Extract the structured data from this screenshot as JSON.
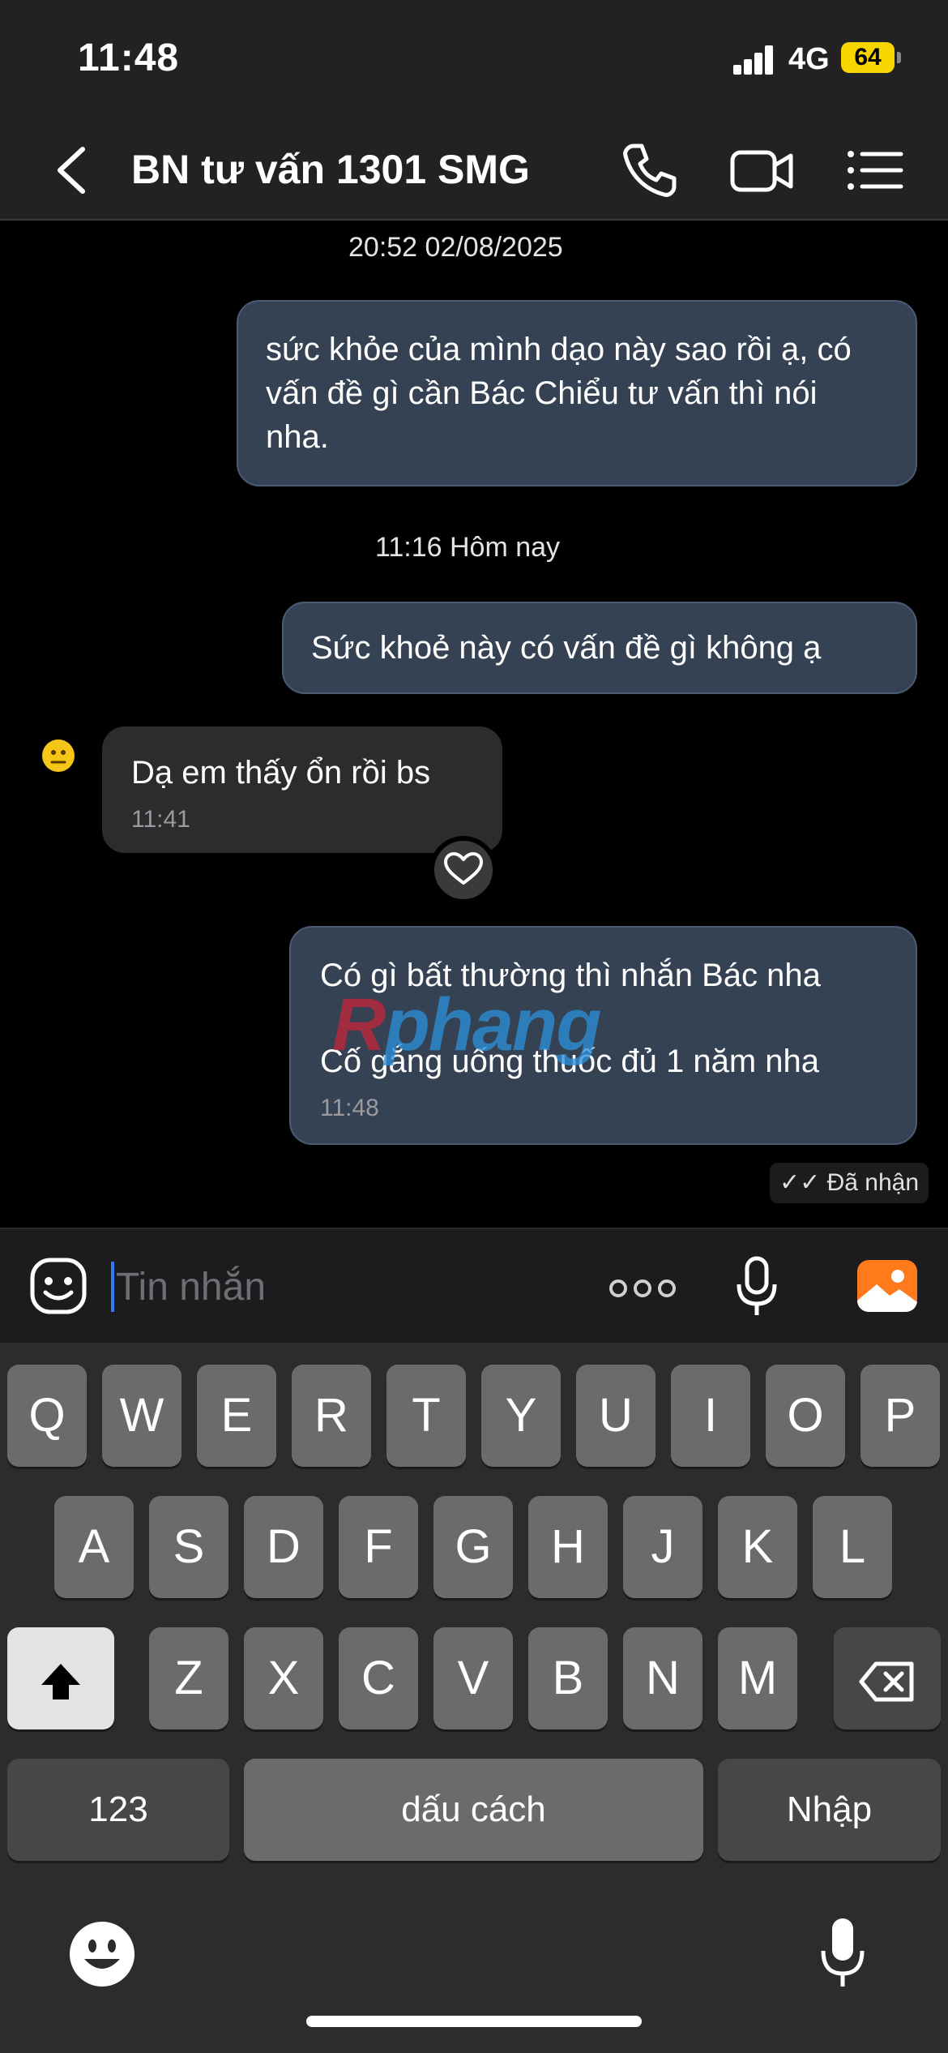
{
  "status": {
    "time": "11:48",
    "network": "4G",
    "battery": "64"
  },
  "header": {
    "title": "BN tư vấn 1301 SMG",
    "icons": [
      "back-chevron-icon",
      "phone-icon",
      "video-call-icon",
      "list-menu-icon"
    ]
  },
  "chat": {
    "stamp1": "20:52 02/08/2025",
    "msg1": "sức khỏe của mình dạo này sao rồi ạ, có vấn đề gì cần Bác Chiểu tư vấn thì nói nha.",
    "stamp2": "11:16 Hôm nay",
    "msg2": "Sức khoẻ này có vấn đề gì không ạ",
    "msg3": "Dạ em thấy ổn rồi bs",
    "msg3_time": "11:41",
    "msg4_line1": "Có gì bất thường thì nhắn Bác nha",
    "msg4_line2": "Cố gắng uống thuốc đủ 1 năm nha",
    "msg4_time": "11:48",
    "received": "Đã nhận",
    "watermark": "Rphang"
  },
  "input": {
    "placeholder": "Tin nhắn"
  },
  "keyboard": {
    "row1": [
      "Q",
      "W",
      "E",
      "R",
      "T",
      "Y",
      "U",
      "I",
      "O",
      "P"
    ],
    "row2": [
      "A",
      "S",
      "D",
      "F",
      "G",
      "H",
      "J",
      "K",
      "L"
    ],
    "row3": [
      "Z",
      "X",
      "C",
      "V",
      "B",
      "N",
      "M"
    ],
    "numbers": "123",
    "space": "dấu cách",
    "enter": "Nhập"
  },
  "colors": {
    "outgoing_bubble": "#354253",
    "incoming_bubble": "#2c2c2e",
    "caret": "#2f7bf5",
    "image_button": "#ff7a1a",
    "battery": "#f7d500"
  }
}
